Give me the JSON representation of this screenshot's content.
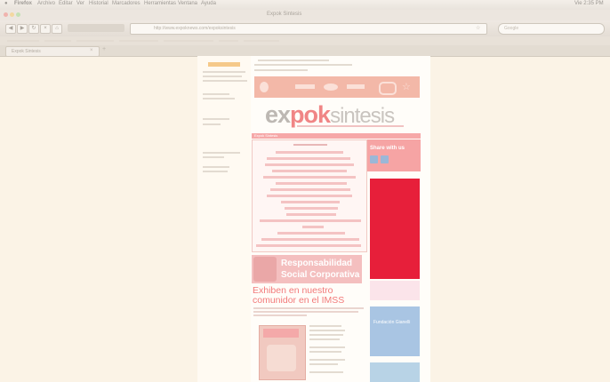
{
  "menubar": {
    "items": [
      "Firefox",
      "Archivo",
      "Editar",
      "Ver",
      "Historial",
      "Marcadores",
      "Herramientas",
      "Ventana",
      "Ayuda"
    ],
    "clock": "Vie 2:35 PM"
  },
  "window": {
    "title": "Expok Sintesis"
  },
  "toolbar": {
    "url": "http://www.expoknews.com/expoksintesis",
    "search_placeholder": "Google"
  },
  "tabs": [
    {
      "label": "Expok Sintesis"
    }
  ],
  "page": {
    "logo": {
      "part1": "ex",
      "part2": "pok",
      "part3": "sintesis"
    },
    "nav_title": "Expok Sintesis",
    "share_title": "Share with us",
    "rsc_line1": "Responsabilidad",
    "rsc_line2": "Social Corporativa",
    "headline": "Exhiben en nuestro comunidor en el IMSS",
    "blue_ad": "Fundación Gianelli"
  },
  "colors": {
    "page_bg": "#fbf3e6",
    "accent_pink": "#f6a8a8",
    "ad_red": "#e71f3a",
    "ad_blue": "#a9c5e3"
  }
}
